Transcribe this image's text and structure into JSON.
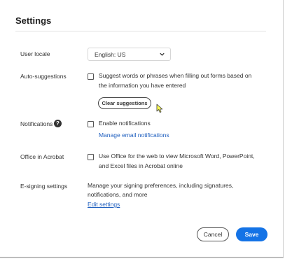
{
  "title": "Settings",
  "user_locale": {
    "label": "User locale",
    "value": "English: US"
  },
  "auto_suggestions": {
    "label": "Auto-suggestions",
    "text_line1": "Suggest words or phrases when filling out forms based on",
    "text_line2": "the information you have entered",
    "checked": false,
    "clear_button": "Clear suggestions"
  },
  "notifications": {
    "label": "Notifications",
    "help_glyph": "?",
    "checkbox_text": "Enable notifications",
    "checked": false,
    "link": "Manage email notifications"
  },
  "office": {
    "label": "Office in Acrobat",
    "text_line1": "Use Office for the web to view Microsoft Word, PowerPoint,",
    "text_line2": "and Excel files in Acrobat online",
    "checked": false
  },
  "esign": {
    "label": "E-signing settings",
    "text_line1": "Manage your signing preferences, including signatures,",
    "text_line2": "notifications, and more",
    "link": "Edit settings"
  },
  "footer": {
    "cancel": "Cancel",
    "save": "Save"
  },
  "colors": {
    "accent": "#1473e6",
    "link": "#1f5fbf"
  },
  "icons": {
    "help": "help-circle-icon",
    "chevron": "chevron-down-icon",
    "cursor": "mouse-cursor-icon"
  }
}
